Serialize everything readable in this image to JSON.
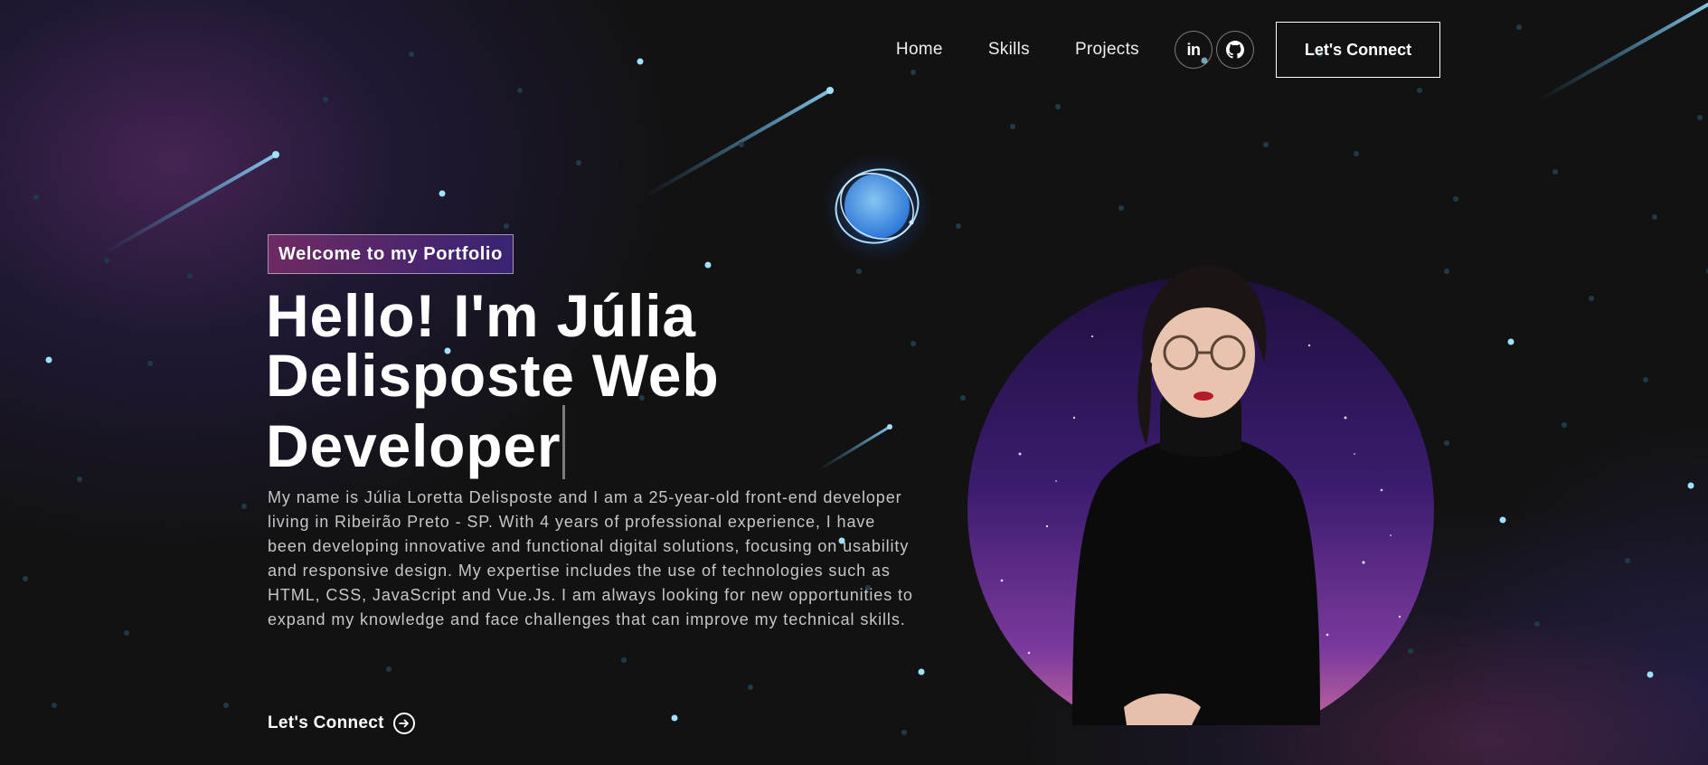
{
  "nav": {
    "links": [
      "Home",
      "Skills",
      "Projects"
    ],
    "social": [
      {
        "label": "in",
        "icon": "linkedin-icon"
      },
      {
        "label": "",
        "icon": "github-icon"
      }
    ],
    "connect_label": "Let's Connect"
  },
  "hero": {
    "tagline": "Welcome to my Portfolio",
    "headline": "Hello! I'm Júlia Delisposte Web Developer",
    "bio": "My name is Júlia Loretta Delisposte and I am a 25-year-old front-end developer living in Ribeirão Preto - SP. With 4 years of professional experience, I have been developing innovative and functional digital solutions, focusing on usability and responsive design. My expertise includes the use of technologies such as HTML, CSS, JavaScript and Vue.Js. I am always looking for new opportunities to expand my knowledge and face challenges that can improve my technical skills.",
    "cta_label": "Let's Connect",
    "cta_icon": "arrow-right-circle-icon"
  },
  "colors": {
    "background": "#121212",
    "tagline_gradient_start": "#AA367C",
    "tagline_gradient_end": "#4A2FBD",
    "star": "#8fd8ff"
  }
}
